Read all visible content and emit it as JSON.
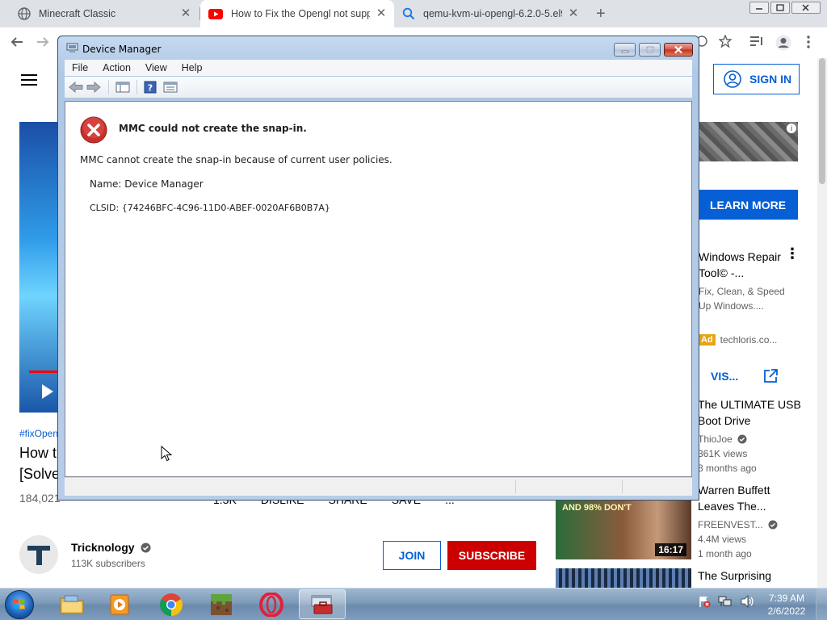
{
  "browser": {
    "tabs": [
      {
        "title": "Minecraft Classic",
        "icon": "globe-icon"
      },
      {
        "title": "How to Fix the Opengl not suppo",
        "icon": "youtube-icon"
      },
      {
        "title": "qemu-kvm-ui-opengl-6.2.0-5.el9",
        "icon": "search-icon"
      }
    ],
    "close_glyph": "✕",
    "newtab_glyph": "+"
  },
  "youtube": {
    "sign_in": "SIGN IN",
    "hashtag": "#fixOpen",
    "title_line1": "How t",
    "title_line2": "[Solve",
    "views": "184,021",
    "actions": [
      "1.3K",
      "DISLIKE",
      "SHARE",
      "SAVE",
      "..."
    ],
    "channel": {
      "name": "Tricknology",
      "subscribers": "113K subscribers"
    },
    "join": "JOIN",
    "subscribe": "SUBSCRIBE",
    "ad": {
      "learn_more": "LEARN MORE",
      "title": "Windows Repair Tool© -...",
      "description": "Fix, Clean, & Speed Up Windows....",
      "badge": "Ad",
      "domain": "techloris.co...",
      "visit": "VIS..."
    },
    "recommendations": [
      {
        "title": "The ULTIMATE USB Boot Drive",
        "channel": "ThioJoe",
        "views": "361K views",
        "age": "8 months ago"
      },
      {
        "title": "Warren Buffett Leaves The...",
        "channel": "FREENVEST...",
        "views": "4.4M views",
        "age": "1 month ago",
        "thumb_caption": "AND 98% DON'T",
        "duration": "16:17"
      },
      {
        "title": "The Surprising"
      }
    ]
  },
  "device_manager": {
    "window_title": "Device Manager",
    "menu": [
      "File",
      "Action",
      "View",
      "Help"
    ],
    "error_title": "MMC could not create the snap-in.",
    "error_message": "MMC cannot create the snap-in because of current user policies.",
    "name_line": "Name: Device Manager",
    "clsid_line": "CLSID: {74246BFC-4C96-11D0-ABEF-0020AF6B0B7A}"
  },
  "taskbar": {
    "time": "7:39 AM",
    "date": "2/6/2022",
    "apps": [
      "file-explorer-icon",
      "media-player-icon",
      "chrome-icon",
      "minecraft-icon",
      "opera-icon",
      "toolbox-icon"
    ]
  },
  "colors": {
    "yt_blue": "#065fd4",
    "yt_red": "#cc0000",
    "aero_blue": "#b7cde8",
    "error_red": "#c9302c"
  }
}
